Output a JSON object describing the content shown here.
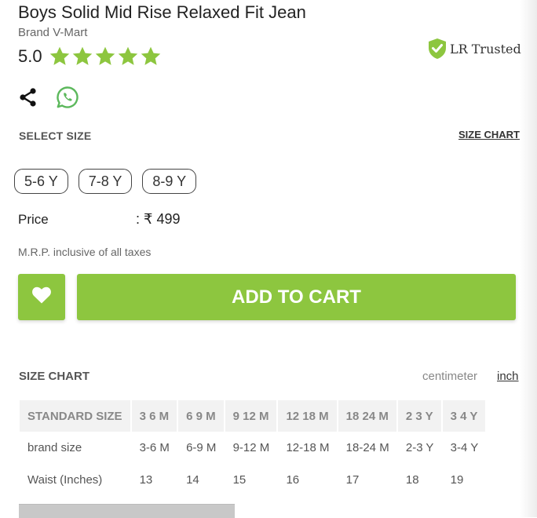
{
  "product": {
    "title": "Boys Solid Mid Rise Relaxed Fit Jean",
    "brand": "Brand V-Mart",
    "rating": "5.0",
    "stars_filled": 5,
    "star_color": "#8dc63f",
    "trust_badge": "LR Trusted"
  },
  "actions": {
    "share_icon": "share-icon",
    "whatsapp_icon": "whatsapp-icon"
  },
  "size_section": {
    "label": "SELECT SIZE",
    "size_chart_link": "SIZE CHART",
    "options": [
      "5-6 Y",
      "7-8 Y",
      "8-9 Y"
    ]
  },
  "price": {
    "label": "Price",
    "value": ": ₹ 499",
    "note": "M.R.P. inclusive of all taxes"
  },
  "buttons": {
    "wishlist_icon": "heart-icon",
    "add_to_cart": "ADD TO CART",
    "accent_color": "#8dc63f"
  },
  "size_chart": {
    "heading": "SIZE CHART",
    "units": {
      "centimeter": "centimeter",
      "inch": "inch"
    },
    "selected_unit": "inch",
    "columns": [
      "STANDARD SIZE",
      "3 6 M",
      "6 9 M",
      "9 12 M",
      "12 18 M",
      "18 24 M",
      "2 3 Y",
      "3 4 Y"
    ],
    "rows": [
      [
        "brand size",
        "3-6 M",
        "6-9 M",
        "9-12 M",
        "12-18 M",
        "18-24 M",
        "2-3 Y",
        "3-4 Y"
      ],
      [
        "Waist (Inches)",
        "13",
        "14",
        "15",
        "16",
        "17",
        "18",
        "19"
      ]
    ]
  }
}
